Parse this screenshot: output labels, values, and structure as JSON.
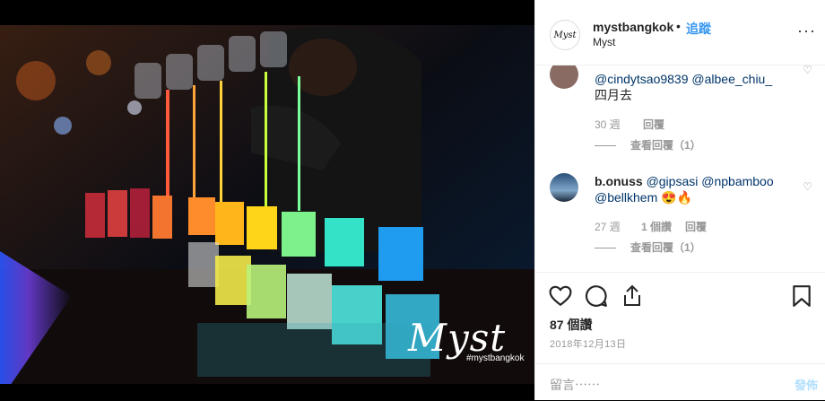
{
  "post": {
    "username": "mystbangkok",
    "separator": "•",
    "follow_label": "追蹤",
    "location": "Myst",
    "more_label": "···"
  },
  "photo": {
    "brand_text": "Myst",
    "brand_handle": "#mystbangkok"
  },
  "comments": [
    {
      "mentions": [
        "@cindytsao9839",
        "@albee_chiu_"
      ],
      "body": "四月去",
      "time": "30 週",
      "reply_label": "回覆",
      "view_replies": "查看回覆（1）"
    },
    {
      "username": "b.onuss",
      "mentions": [
        "@gipsasi",
        "@npbamboo",
        "@bellkhem"
      ],
      "emoji": "😍🔥",
      "time": "27 週",
      "likes": "1 個讚",
      "reply_label": "回覆",
      "view_replies": "查看回覆（1）"
    }
  ],
  "actions": {
    "likes": "87 個讚",
    "date": "2018年12月13日"
  },
  "composer": {
    "placeholder": "留言⋯⋯",
    "post_label": "發佈"
  },
  "colors": {
    "follow": "#3897f0",
    "mention": "#003569",
    "post_disabled": "#b2dffc"
  }
}
